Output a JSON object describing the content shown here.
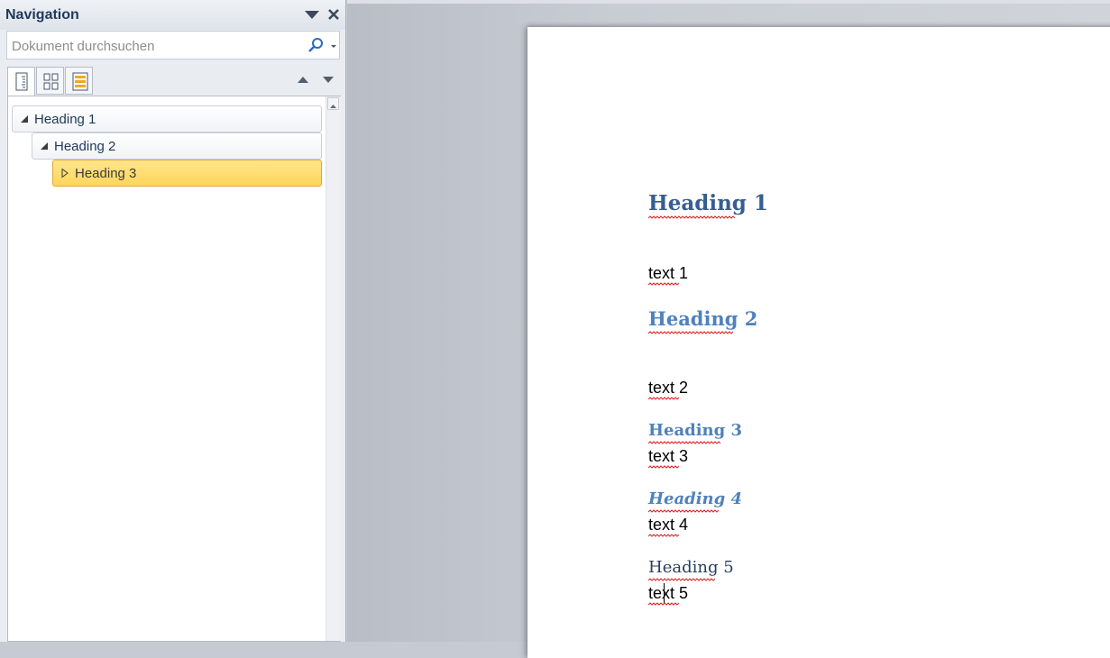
{
  "nav_pane": {
    "title": "Navigation",
    "search": {
      "placeholder": "Dokument durchsuchen",
      "value": ""
    },
    "tabs": [
      {
        "name": "headings-tab",
        "icon": "document-headings-icon",
        "active": true
      },
      {
        "name": "pages-tab",
        "icon": "page-thumbnails-icon",
        "active": false
      },
      {
        "name": "results-tab",
        "icon": "search-results-icon",
        "active": false
      }
    ],
    "tree": [
      {
        "label": "Heading 1",
        "level": 1,
        "expanded": true,
        "selected": false
      },
      {
        "label": "Heading 2",
        "level": 2,
        "expanded": true,
        "selected": false
      },
      {
        "label": "Heading 3",
        "level": 3,
        "expanded": false,
        "selected": true
      }
    ]
  },
  "document": {
    "heading1": "Heading 1",
    "text1": "text 1",
    "heading2": "Heading 2",
    "text2": "text 2",
    "heading3": "Heading 3",
    "text3": "text 3",
    "heading4": "Heading 4",
    "text4": "text 4",
    "heading5": "Heading 5",
    "text5": "text 5"
  },
  "colors": {
    "heading1": "#365f91",
    "heading2_3_4": "#4f81bd",
    "heading5": "#243f60",
    "selected_item": "#ffd65a",
    "spellcheck": "#e02020"
  }
}
